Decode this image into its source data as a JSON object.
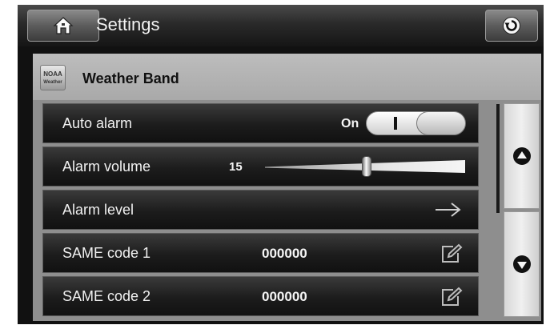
{
  "header": {
    "title": "Settings",
    "home_icon": "home-icon",
    "back_icon": "back-icon"
  },
  "section": {
    "title": "Weather Band",
    "logo_icon": "noaa-weather-icon",
    "logo_text": "Weather"
  },
  "rows": {
    "auto_alarm": {
      "label": "Auto alarm",
      "state_label": "On",
      "state": true
    },
    "alarm_volume": {
      "label": "Alarm volume",
      "value": "15",
      "level_fraction": 0.51
    },
    "alarm_level": {
      "label": "Alarm level",
      "icon": "arrow-right-icon"
    },
    "same_code_1": {
      "label": "SAME code 1",
      "value": "000000",
      "icon": "edit-icon"
    },
    "same_code_2": {
      "label": "SAME code 2",
      "value": "000000",
      "icon": "edit-icon"
    }
  },
  "scroll": {
    "up_icon": "scroll-up-icon",
    "down_icon": "scroll-down-icon"
  }
}
